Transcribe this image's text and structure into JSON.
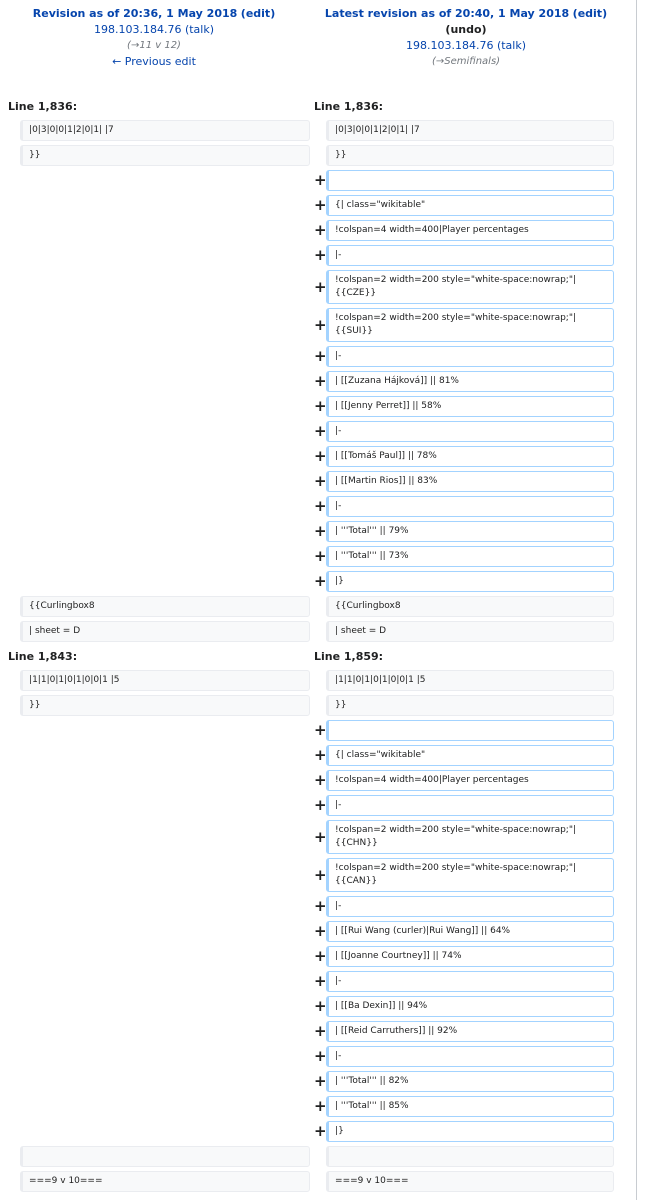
{
  "left_header": {
    "title": "Revision as of 20:36, 1 May 2018",
    "edit": "(edit)",
    "user": "198.103.184.76",
    "talk": "(talk)",
    "comment": "(→11 v 12)",
    "prev": "← Previous edit"
  },
  "right_header": {
    "title": "Latest revision as of 20:40, 1 May 2018",
    "edit": "(edit)",
    "undo": "(undo)",
    "user": "198.103.184.76",
    "talk": "(talk)",
    "comment": "(→Semifinals)"
  },
  "sections": [
    {
      "left_line": "Line 1,836:",
      "right_line": "Line 1,836:",
      "rows": [
        {
          "type": "context",
          "left": "|0|3|0|0|1|2|0|1| |7",
          "right": "|0|3|0|0|1|2|0|1| |7"
        },
        {
          "type": "context",
          "left": "}}",
          "right": "}}"
        },
        {
          "type": "added",
          "right": ""
        },
        {
          "type": "added",
          "right": "{| class=\"wikitable\""
        },
        {
          "type": "added",
          "right": "!colspan=4 width=400|Player percentages"
        },
        {
          "type": "added",
          "right": "|-"
        },
        {
          "type": "added",
          "right": "!colspan=2 width=200 style=\"white-space:nowrap;\"|\n{{CZE}}"
        },
        {
          "type": "added",
          "right": "!colspan=2 width=200 style=\"white-space:nowrap;\"|\n{{SUI}}"
        },
        {
          "type": "added",
          "right": "|-"
        },
        {
          "type": "added",
          "right": "| [[Zuzana Hájková]] || 81%"
        },
        {
          "type": "added",
          "right": "| [[Jenny Perret]] || 58%"
        },
        {
          "type": "added",
          "right": "|-"
        },
        {
          "type": "added",
          "right": "| [[Tomáš Paul]] || 78%"
        },
        {
          "type": "added",
          "right": "| [[Martin Rios]] || 83%"
        },
        {
          "type": "added",
          "right": "|-"
        },
        {
          "type": "added",
          "right": "| '''Total''' || 79%"
        },
        {
          "type": "added",
          "right": "| '''Total''' || 73%"
        },
        {
          "type": "added",
          "right": "|}"
        },
        {
          "type": "context",
          "left": "{{Curlingbox8",
          "right": "{{Curlingbox8"
        },
        {
          "type": "context",
          "left": "| sheet = D",
          "right": "| sheet = D"
        }
      ]
    },
    {
      "left_line": "Line 1,843:",
      "right_line": "Line 1,859:",
      "rows": [
        {
          "type": "context",
          "left": "|1|1|0|1|0|1|0|0|1 |5",
          "right": "|1|1|0|1|0|1|0|0|1 |5"
        },
        {
          "type": "context",
          "left": "}}",
          "right": "}}"
        },
        {
          "type": "added",
          "right": ""
        },
        {
          "type": "added",
          "right": "{| class=\"wikitable\""
        },
        {
          "type": "added",
          "right": "!colspan=4 width=400|Player percentages"
        },
        {
          "type": "added",
          "right": "|-"
        },
        {
          "type": "added",
          "right": "!colspan=2 width=200 style=\"white-space:nowrap;\"|\n{{CHN}}"
        },
        {
          "type": "added",
          "right": "!colspan=2 width=200 style=\"white-space:nowrap;\"|\n{{CAN}}"
        },
        {
          "type": "added",
          "right": "|-"
        },
        {
          "type": "added",
          "right": "| [[Rui Wang (curler)|Rui Wang]] || 64%"
        },
        {
          "type": "added",
          "right": "| [[Joanne Courtney]] || 74%"
        },
        {
          "type": "added",
          "right": "|-"
        },
        {
          "type": "added",
          "right": "| [[Ba Dexin]] || 94%"
        },
        {
          "type": "added",
          "right": "| [[Reid Carruthers]] || 92%"
        },
        {
          "type": "added",
          "right": "|-"
        },
        {
          "type": "added",
          "right": "| '''Total''' || 82%"
        },
        {
          "type": "added",
          "right": "| '''Total''' || 85%"
        },
        {
          "type": "added",
          "right": "|}"
        },
        {
          "type": "context",
          "left": "",
          "right": ""
        },
        {
          "type": "context",
          "left": "===9 v 10===",
          "right": "===9 v 10==="
        }
      ]
    }
  ],
  "marker_plus": "+"
}
